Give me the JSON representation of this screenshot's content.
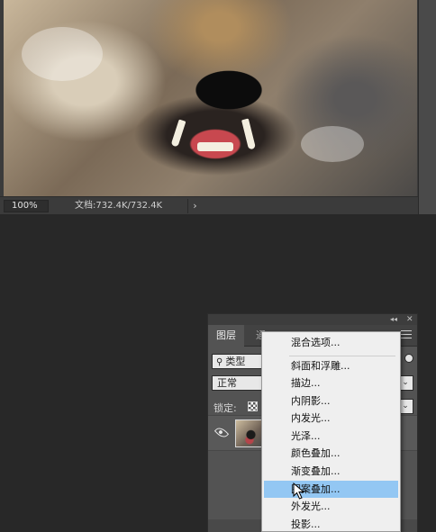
{
  "document": {
    "zoom": "100%",
    "doc_info": "文档:732.4K/732.4K",
    "arrow_glyph": "›"
  },
  "layers_panel": {
    "tabs": [
      "图层",
      "通"
    ],
    "filter": {
      "glyph": "⚲",
      "label": "类型"
    },
    "blend_mode": "正常",
    "lock_label": "锁定:",
    "select_arrow": "⌄",
    "collapse_glyph": "◂◂",
    "close_glyph": "✕"
  },
  "context_menu": {
    "items": [
      "混合选项...",
      "斜面和浮雕...",
      "描边...",
      "内阴影...",
      "内发光...",
      "光泽...",
      "颜色叠加...",
      "渐变叠加...",
      "图案叠加...",
      "外发光...",
      "投影..."
    ],
    "highlighted_index": 8
  },
  "colors": {
    "menu_highlight": "#93c7f3",
    "panel_bg": "#535353",
    "workspace_bg": "#282828"
  },
  "icons": [
    "search-icon",
    "eye-icon",
    "lock-pixels-icon",
    "panel-menu-icon",
    "close-icon",
    "collapse-icon",
    "mouse-cursor-icon"
  ]
}
